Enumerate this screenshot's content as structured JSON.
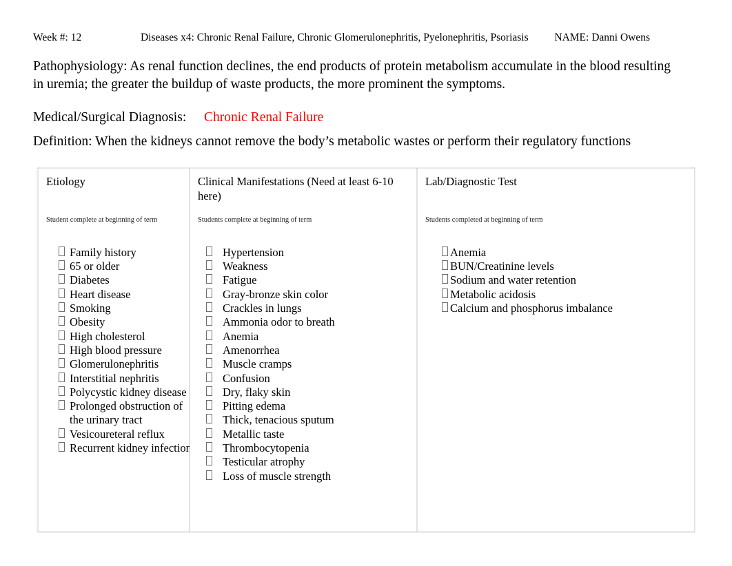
{
  "header": {
    "week": "Week #: 12",
    "diseases": "Diseases x4: Chronic Renal Failure, Chronic Glomerulonephritis, Pyelonephritis, Psoriasis",
    "name": "NAME: Danni Owens"
  },
  "pathophysiology": {
    "label": "Pathophysiology:",
    "text": "Pathophysiology:  As renal function declines, the end products of protein metabolism accumulate in the blood resulting in uremia; the greater the buildup of waste products, the more prominent the symptoms."
  },
  "diagnosis": {
    "label": "Medical/Surgical Diagnosis:",
    "value": "Chronic Renal Failure",
    "value_color": "#FF0000"
  },
  "definition": {
    "text": "Definition:  When the kidneys cannot remove the body’s metabolic wastes or perform their regulatory functions"
  },
  "table": {
    "columns": [
      {
        "title": "Etiology",
        "subtitle": "Student complete at beginning of term",
        "items": [
          "Family history",
          "65 or older",
          "Diabetes",
          "Heart disease",
          "Smoking",
          "Obesity",
          "High cholesterol",
          "High blood pressure",
          "Glomerulonephritis",
          "Interstitial nephritis",
          "Polycystic kidney disease",
          "Prolonged obstruction of the urinary tract",
          "Vesicoureteral reflux",
          "Recurrent kidney infection"
        ]
      },
      {
        "title": "Clinical Manifestations (Need at least 6-10 here)",
        "subtitle": "Students complete at beginning of term",
        "items": [
          "Hypertension",
          "Weakness",
          "Fatigue",
          "Gray-bronze skin color",
          "Crackles in lungs",
          "Ammonia odor to breath",
          "Anemia",
          "Amenorrhea",
          "Muscle cramps",
          "Confusion",
          "Dry, flaky skin",
          "Pitting edema",
          "Thick, tenacious sputum",
          "Metallic taste",
          "Thrombocytopenia",
          "Testicular atrophy",
          "Loss of muscle strength"
        ]
      },
      {
        "title": "Lab/Diagnostic Test",
        "subtitle": "Students completed at beginning of term",
        "items": [
          "Anemia",
          "BUN/Creatinine levels",
          "Sodium and water retention",
          "Metabolic acidosis",
          "Calcium and phosphorus imbalance"
        ]
      }
    ]
  }
}
